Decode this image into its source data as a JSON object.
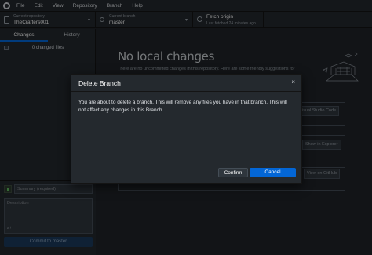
{
  "menubar": {
    "items": [
      "File",
      "Edit",
      "View",
      "Repository",
      "Branch",
      "Help"
    ]
  },
  "toolbar": {
    "repository": {
      "label": "Current repository",
      "value": "TheCrafters001"
    },
    "branch": {
      "label": "Current branch",
      "value": "master"
    },
    "fetch": {
      "label": "Fetch origin",
      "value": "Last fetched 24 minutes ago"
    }
  },
  "sidebar": {
    "tabs": [
      "Changes",
      "History"
    ],
    "changed_files": "0 changed files",
    "summary_placeholder": "Summary (required)",
    "description_placeholder": "Description",
    "commit_button": "Commit to master"
  },
  "main": {
    "title": "No local changes",
    "subtitle": "There are no uncommitted changes in this repository. Here are some friendly suggestions for",
    "visual_studio_code_button": "isual Studio Code",
    "show_in_explorer_button": "Show in Explorer",
    "view_on_github_button": "View on GitHub"
  },
  "dialog": {
    "title": "Delete Branch",
    "close_glyph": "×",
    "message": "You are about to delete a branch. This will remove any files you have in that branch. This will not affect any changes in this Branch.",
    "confirm_label": "Confirm",
    "cancel_label": "Cancel"
  },
  "colors": {
    "accent": "#0366d6",
    "background": "#1f2428",
    "panel": "#24292e"
  },
  "icons": {
    "app": "github-logo-icon",
    "repository": "repository-icon",
    "branch": "branch-icon",
    "fetch": "sync-icon",
    "close": "close-icon"
  }
}
